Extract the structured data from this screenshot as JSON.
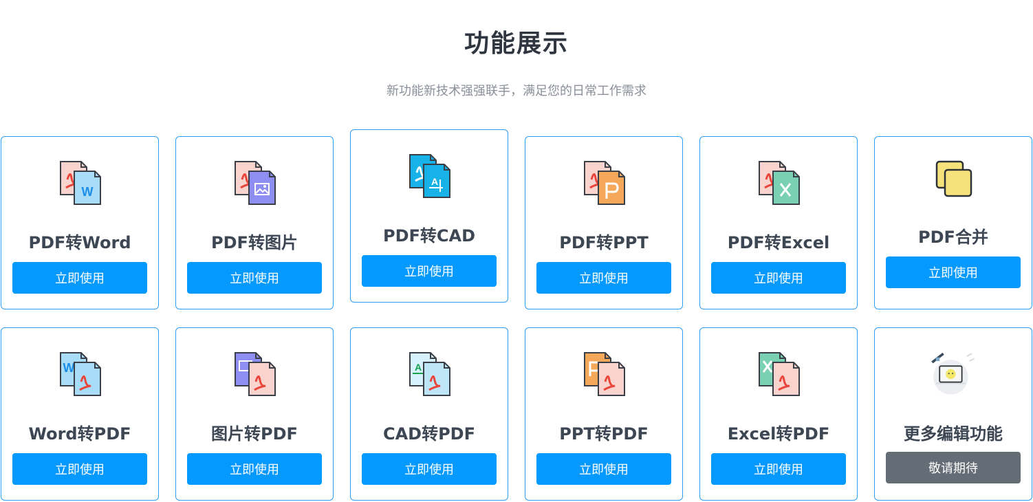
{
  "header": {
    "title": "功能展示",
    "subtitle": "新功能新技术强强联手，满足您的日常工作需求"
  },
  "cards": [
    {
      "label": "PDF转Word",
      "button": "立即使用",
      "icon": "pdf-to-word-icon"
    },
    {
      "label": "PDF转图片",
      "button": "立即使用",
      "icon": "pdf-to-image-icon"
    },
    {
      "label": "PDF转CAD",
      "button": "立即使用",
      "icon": "pdf-to-cad-icon"
    },
    {
      "label": "PDF转PPT",
      "button": "立即使用",
      "icon": "pdf-to-ppt-icon"
    },
    {
      "label": "PDF转Excel",
      "button": "立即使用",
      "icon": "pdf-to-excel-icon"
    },
    {
      "label": "PDF合并",
      "button": "立即使用",
      "icon": "pdf-merge-icon"
    },
    {
      "label": "Word转PDF",
      "button": "立即使用",
      "icon": "word-to-pdf-icon"
    },
    {
      "label": "图片转PDF",
      "button": "立即使用",
      "icon": "image-to-pdf-icon"
    },
    {
      "label": "CAD转PDF",
      "button": "立即使用",
      "icon": "cad-to-pdf-icon"
    },
    {
      "label": "PPT转PDF",
      "button": "立即使用",
      "icon": "ppt-to-pdf-icon"
    },
    {
      "label": "Excel转PDF",
      "button": "立即使用",
      "icon": "excel-to-pdf-icon"
    },
    {
      "label": "更多编辑功能",
      "button": "敬请期待",
      "icon": "more-features-icon"
    }
  ],
  "colors": {
    "accent": "#0399ff",
    "border": "#2a9df4",
    "muted_button": "#646d75"
  }
}
